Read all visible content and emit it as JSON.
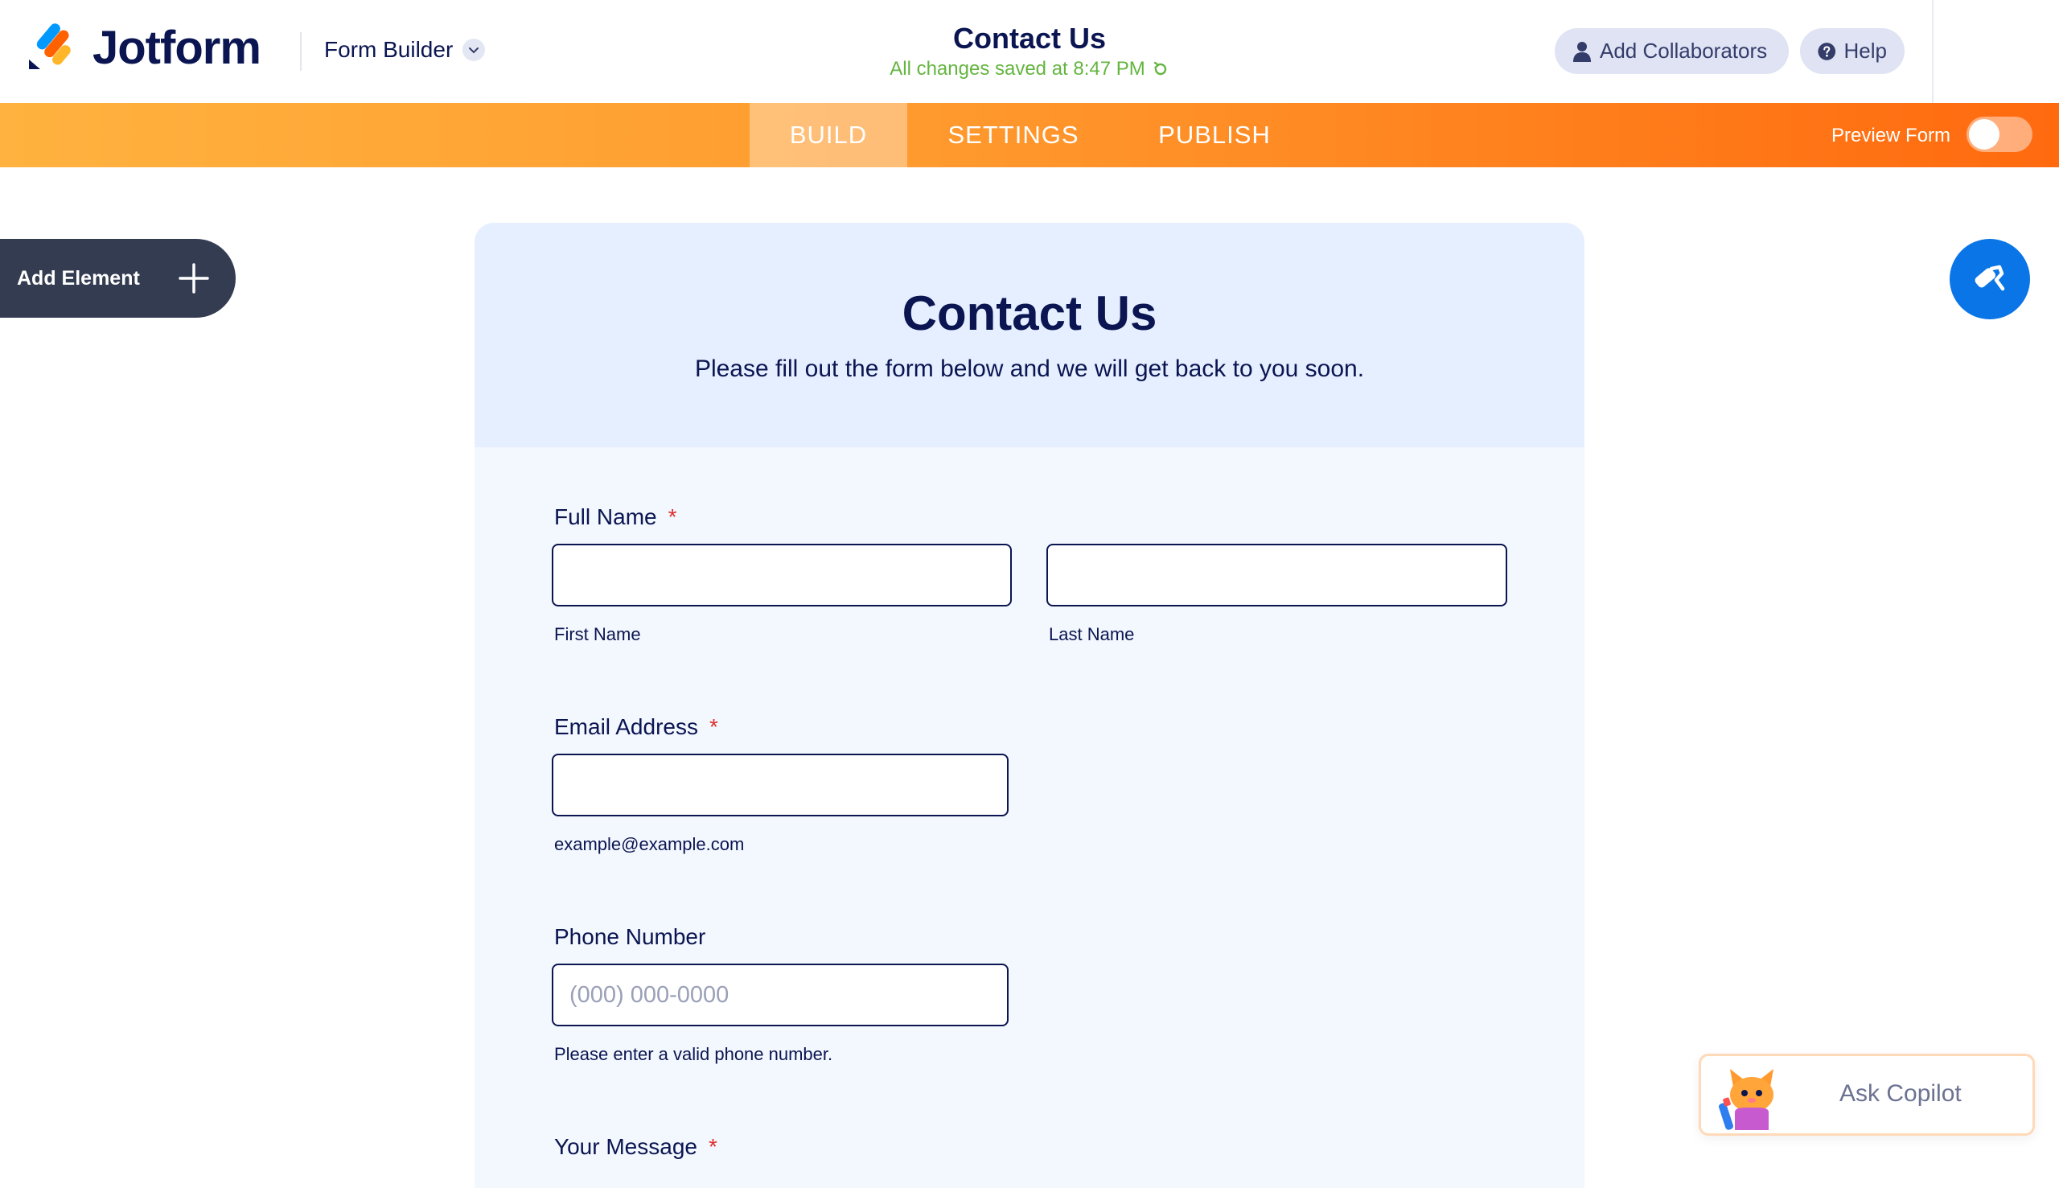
{
  "app": {
    "brand": "Jotform",
    "builder_label": "Form Builder"
  },
  "header": {
    "form_title": "Contact Us",
    "saved_status": "All changes saved at 8:47 PM",
    "collaborators_label": "Add Collaborators",
    "help_label": "Help"
  },
  "nav": {
    "tabs": [
      {
        "label": "BUILD",
        "active": true
      },
      {
        "label": "SETTINGS",
        "active": false
      },
      {
        "label": "PUBLISH",
        "active": false
      }
    ],
    "preview_label": "Preview Form",
    "preview_enabled": false
  },
  "sidebar": {
    "add_element_label": "Add Element"
  },
  "form": {
    "title": "Contact Us",
    "subtitle": "Please fill out the form below and we will get back to you soon.",
    "full_name": {
      "label": "Full Name",
      "required_mark": "*",
      "first_sublabel": "First Name",
      "last_sublabel": "Last Name",
      "first_value": "",
      "last_value": ""
    },
    "email": {
      "label": "Email Address",
      "required_mark": "*",
      "sublabel": "example@example.com",
      "value": ""
    },
    "phone": {
      "label": "Phone Number",
      "placeholder": "(000) 000-0000",
      "sublabel": "Please enter a valid phone number."
    },
    "message": {
      "label": "Your Message",
      "required_mark": "*"
    }
  },
  "copilot": {
    "label": "Ask Copilot"
  },
  "colors": {
    "navy": "#0a1551",
    "orange_start": "#ffb23f",
    "orange_end": "#ff6a0f",
    "saved_green": "#64b540",
    "designer_blue": "#0a75e6",
    "required_red": "#e02e2e"
  },
  "icons": [
    "jotform-logo-icon",
    "chevron-down-icon",
    "refresh-icon",
    "user-icon",
    "question-circle-icon",
    "plus-icon",
    "paint-roller-icon",
    "copilot-cat-icon"
  ]
}
